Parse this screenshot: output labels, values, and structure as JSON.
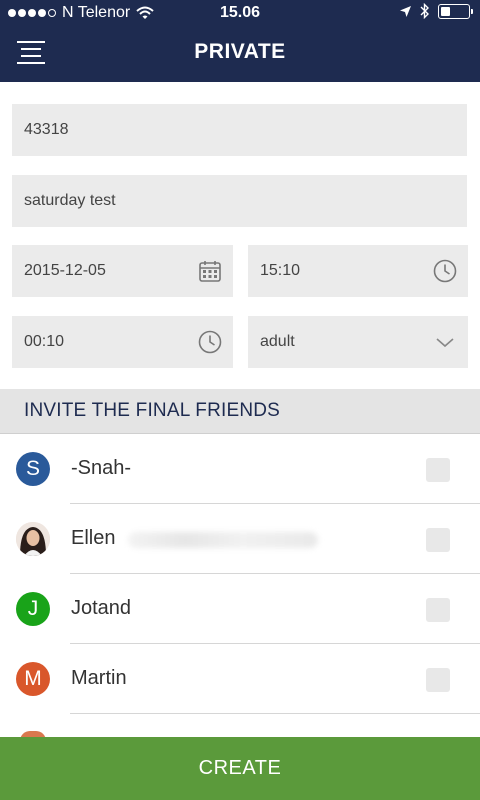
{
  "status_bar": {
    "carrier": "N Telenor",
    "time": "15.06",
    "signal_dots_filled": 4,
    "signal_dots_total": 5
  },
  "header": {
    "title": "PRIVATE",
    "background_color": "#1e2b50"
  },
  "form": {
    "id_value": "43318",
    "name_value": "saturday test",
    "date_value": "2015-12-05",
    "date_icon": "calendar-icon",
    "time_value": "15:10",
    "time_icon": "clock-icon",
    "duration_value": "00:10",
    "duration_icon": "clock-icon",
    "category_value": "adult",
    "category_icon": "chevron-down-icon"
  },
  "invite": {
    "heading": "INVITE THE FINAL FRIENDS",
    "friends": [
      {
        "initial": "S",
        "name": "-Snah-",
        "avatar_color": "#2a5a9a",
        "checked": false
      },
      {
        "initial": "",
        "name": "Ellen",
        "avatar_type": "photo",
        "checked": false
      },
      {
        "initial": "J",
        "name": "Jotand",
        "avatar_color": "#19a319",
        "checked": false
      },
      {
        "initial": "M",
        "name": "Martin",
        "avatar_color": "#d9572b",
        "checked": false
      }
    ]
  },
  "footer": {
    "create_label": "CREATE",
    "button_color": "#5b9a3b"
  }
}
